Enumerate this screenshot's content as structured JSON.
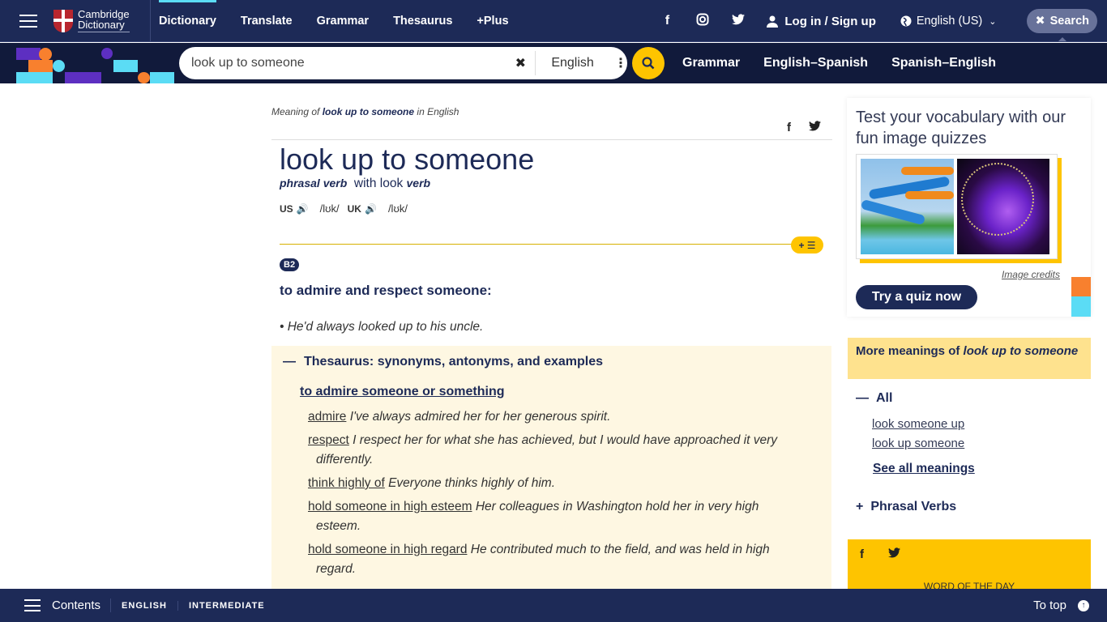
{
  "header": {
    "logo_line1": "Cambridge",
    "logo_line2": "Dictionary",
    "nav": [
      "Dictionary",
      "Translate",
      "Grammar",
      "Thesaurus",
      "+Plus"
    ],
    "login_label": "Log in / Sign up",
    "language_label": "English (US)",
    "search_toggle_label": "Search"
  },
  "search": {
    "query": "look up to someone",
    "dictionary_select": "English",
    "quick_links": [
      "Grammar",
      "English–Spanish",
      "Spanish–English"
    ]
  },
  "entry": {
    "meaning_prefix": "Meaning of ",
    "meaning_term": "look up to someone",
    "meaning_suffix": " in English",
    "headword": "look up to someone",
    "pos": "phrasal verb",
    "with_text": "with look",
    "with_pos": "verb",
    "us_label": "US",
    "us_ipa": "/lʊk/",
    "uk_label": "UK",
    "uk_ipa": "/lʊk/",
    "add_to_list_label": "+ ☰",
    "level": "B2",
    "definition": "to admire and respect someone:",
    "example": "He'd always looked up to his uncle."
  },
  "thesaurus": {
    "heading": "Thesaurus: synonyms, antonyms, and examples",
    "subheading": "to admire someone or something",
    "items": [
      {
        "word": "admire",
        "example": "I've always admired her for her generous spirit.",
        "cont": ""
      },
      {
        "word": "respect",
        "example": "I respect her for what she has achieved, but I would have approached it very",
        "cont": "differently."
      },
      {
        "word": "think highly of",
        "example": "Everyone thinks highly of him.",
        "cont": ""
      },
      {
        "word": "hold someone in high esteem",
        "example": "Her colleagues in Washington hold her in very high",
        "cont": "esteem."
      },
      {
        "word": "hold someone in high regard",
        "example": "He contributed much to the field, and was held in high",
        "cont": "regard."
      }
    ]
  },
  "quiz": {
    "title": "Test your vocabulary with our fun image quizzes",
    "credits": "Image credits",
    "button": "Try a quiz now"
  },
  "more_meanings": {
    "prefix": "More meanings of ",
    "term": "look up to someone",
    "all_label": "All",
    "links": [
      "look someone up",
      "look up someone"
    ],
    "see_all": "See all meanings",
    "phrasal_verbs_label": "Phrasal Verbs"
  },
  "wotd": {
    "label": "WORD OF THE DAY"
  },
  "footer": {
    "contents_label": "Contents",
    "tags": [
      "ENGLISH",
      "INTERMEDIATE"
    ],
    "to_top": "To top"
  },
  "colors": {
    "brand_navy": "#1d2a57",
    "accent_yellow": "#fec400",
    "thesaurus_bg": "#fef7e2"
  }
}
